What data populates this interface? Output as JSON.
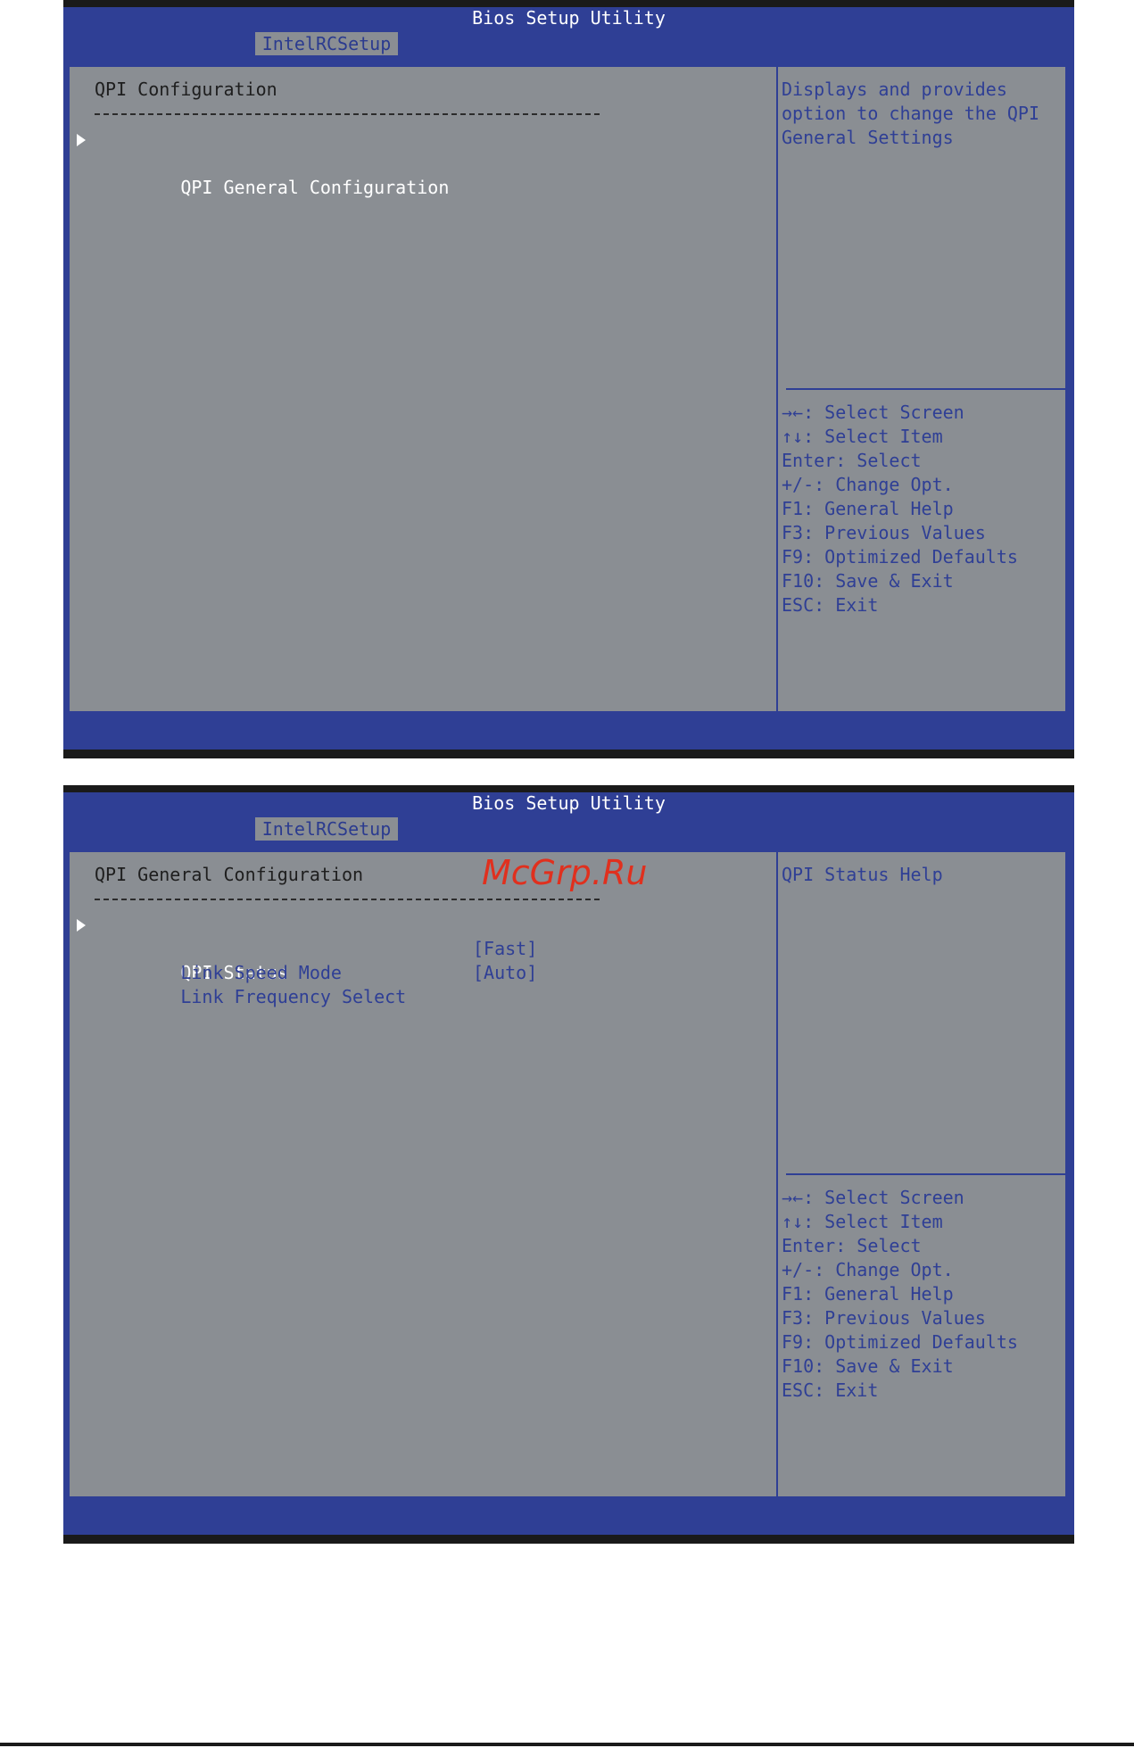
{
  "screen1": {
    "title": "Bios Setup Utility",
    "tab": "IntelRCSetup",
    "heading": "QPI Configuration",
    "items": [
      {
        "label": "QPI General Configuration",
        "type": "submenu"
      }
    ],
    "help": [
      "Displays and provides",
      "option to change the QPI",
      "General Settings"
    ],
    "keys": [
      "→←: Select Screen",
      "↑↓: Select Item",
      "Enter: Select",
      "+/-: Change Opt.",
      "F1: General Help",
      "F3: Previous Values",
      "F9: Optimized Defaults",
      "F10: Save & Exit",
      "ESC: Exit"
    ]
  },
  "screen2": {
    "title": "Bios Setup Utility",
    "tab": "IntelRCSetup",
    "heading": "QPI General Configuration",
    "items": [
      {
        "label": "QPI Status",
        "type": "submenu"
      },
      {
        "label": "Link Speed Mode",
        "value": "[Fast]",
        "type": "option"
      },
      {
        "label": "Link Frequency Select",
        "value": "[Auto]",
        "type": "option"
      }
    ],
    "help": [
      "QPI Status Help"
    ],
    "keys": [
      "→←: Select Screen",
      "↑↓: Select Item",
      "Enter: Select",
      "+/-: Change Opt.",
      "F1: General Help",
      "F3: Previous Values",
      "F9: Optimized Defaults",
      "F10: Save & Exit",
      "ESC: Exit"
    ]
  },
  "watermark": "McGrp.Ru",
  "colors": {
    "bios_blue": "#2f3f95",
    "panel_gray": "#8a8e93",
    "highlight_white": "#ffffff",
    "watermark_red": "#e0301e"
  },
  "icons": {
    "submenu_marker": "triangle-right-icon"
  }
}
